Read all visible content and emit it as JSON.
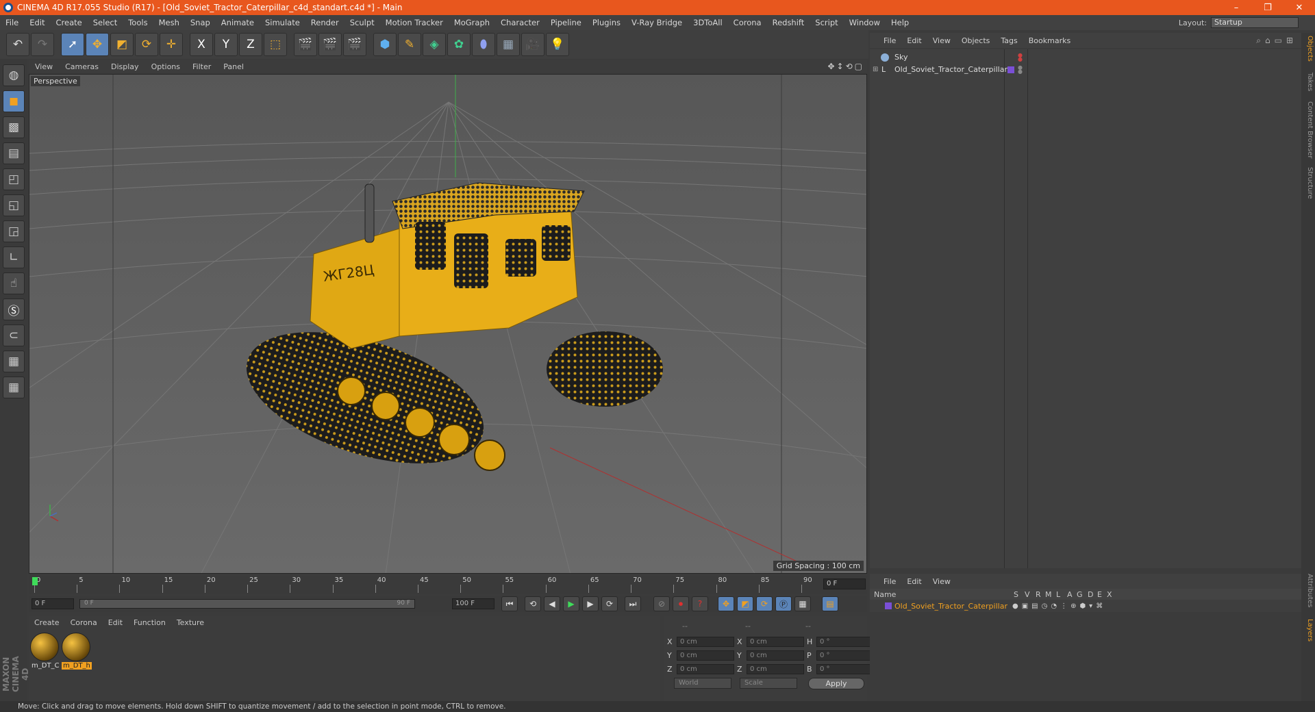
{
  "window": {
    "title": "CINEMA 4D R17.055 Studio (R17) - [Old_Soviet_Tractor_Caterpillar_c4d_standart.c4d *] - Main",
    "controls": [
      "–",
      "❐",
      "✕"
    ]
  },
  "menubar": {
    "items": [
      "File",
      "Edit",
      "Create",
      "Select",
      "Tools",
      "Mesh",
      "Snap",
      "Animate",
      "Simulate",
      "Render",
      "Sculpt",
      "Motion Tracker",
      "MoGraph",
      "Character",
      "Pipeline",
      "Plugins",
      "V-Ray Bridge",
      "3DToAll",
      "Corona",
      "Redshift",
      "Script",
      "Window",
      "Help"
    ],
    "layout_label": "Layout:",
    "layout_value": "Startup"
  },
  "toolbar": {
    "axis_x": "X",
    "axis_y": "Y",
    "axis_z": "Z"
  },
  "viewport": {
    "menu": [
      "View",
      "Cameras",
      "Display",
      "Options",
      "Filter",
      "Panel"
    ],
    "label": "Perspective",
    "grid_spacing": "Grid Spacing : 100 cm",
    "model_text": "ЖГ28Ц"
  },
  "timeline": {
    "ticks": [
      "0",
      "5",
      "10",
      "15",
      "20",
      "25",
      "30",
      "35",
      "40",
      "45",
      "50",
      "55",
      "60",
      "65",
      "70",
      "75",
      "80",
      "85",
      "90"
    ],
    "current_frame": "0 F"
  },
  "transport": {
    "start": "0 F",
    "range_start": "0 F",
    "range_end": "90 F",
    "end": "100 F"
  },
  "materials": {
    "menu": [
      "Create",
      "Corona",
      "Edit",
      "Function",
      "Texture"
    ],
    "items": [
      {
        "name": "m_DT_C",
        "selected": false
      },
      {
        "name": "m_DT_h",
        "selected": true
      }
    ]
  },
  "coordinates": {
    "header": [
      "--",
      "--",
      "--"
    ],
    "rows": [
      {
        "a1": "X",
        "v1": "0 cm",
        "a2": "X",
        "v2": "0 cm",
        "a3": "H",
        "v3": "0 °"
      },
      {
        "a1": "Y",
        "v1": "0 cm",
        "a2": "Y",
        "v2": "0 cm",
        "a3": "P",
        "v3": "0 °"
      },
      {
        "a1": "Z",
        "v1": "0 cm",
        "a2": "Z",
        "v2": "0 cm",
        "a3": "B",
        "v3": "0 °"
      }
    ],
    "mode": "World",
    "scale": "Scale",
    "apply": "Apply"
  },
  "objects": {
    "menu": [
      "File",
      "Edit",
      "View",
      "Objects",
      "Tags",
      "Bookmarks"
    ],
    "rows": [
      {
        "name": "Sky",
        "color": "#ffffff"
      },
      {
        "name": "Old_Soviet_Tractor_Caterpillar",
        "color": "#7a4fd6"
      }
    ]
  },
  "side_tabs": [
    "Objects",
    "Takes",
    "Content Browser",
    "Structure"
  ],
  "side_tabs_bottom": [
    "Attributes",
    "Layers"
  ],
  "layers": {
    "menu": [
      "File",
      "Edit",
      "View"
    ],
    "columns": [
      "Name",
      "S",
      "V",
      "R",
      "M",
      "L",
      "A",
      "G",
      "D",
      "E",
      "X"
    ],
    "rows": [
      {
        "name": "Old_Soviet_Tractor_Caterpillar",
        "color": "#7a4fd6"
      }
    ]
  },
  "status": "Move: Click and drag to move elements. Hold down SHIFT to quantize movement / add to the selection in point mode, CTRL to remove."
}
